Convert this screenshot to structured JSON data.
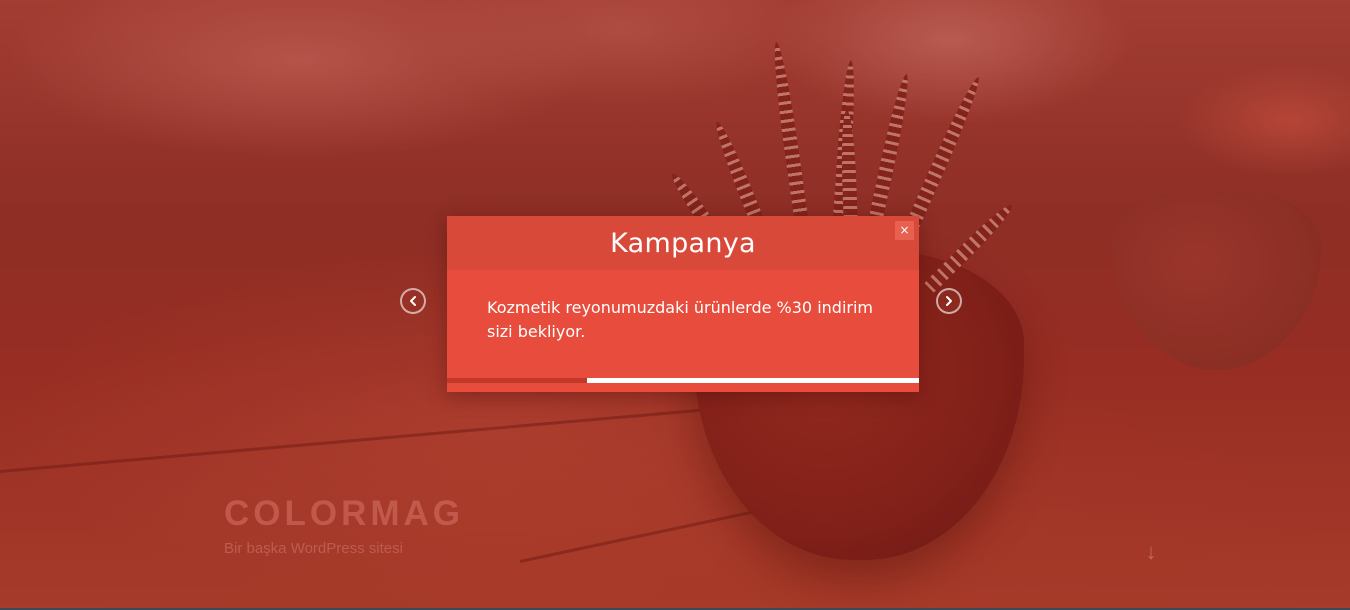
{
  "site": {
    "title": "COLORMAG",
    "description": "Bir başka WordPress sitesi"
  },
  "icons": {
    "prev": "chevron-left-icon",
    "next": "chevron-right-icon",
    "scroll": "arrow-down-icon",
    "close": "close-icon"
  },
  "popup": {
    "title": "Kampanya",
    "close_label": "×",
    "message": "Kozmetik reyonumuzdaki ürünlerde %30 indirim sizi bekliyor.",
    "progress": 0.297
  },
  "scroll_down": {
    "label": "↓"
  },
  "colors": {
    "popup_bg": "#e74c3c",
    "popup_header_bg": "#d8493a",
    "overlay_tint": "#a8402e"
  }
}
